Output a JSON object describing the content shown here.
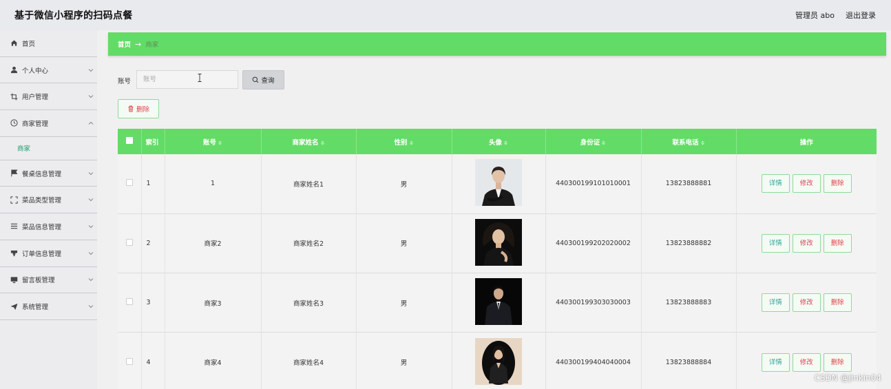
{
  "header": {
    "title": "基于微信小程序的扫码点餐",
    "user": "管理员 abo",
    "logout": "退出登录"
  },
  "sidebar": {
    "items": [
      {
        "label": "首页",
        "icon": "home-icon"
      },
      {
        "label": "个人中心",
        "icon": "user-icon"
      },
      {
        "label": "用户管理",
        "icon": "crop-icon"
      },
      {
        "label": "商家管理",
        "icon": "clock-icon",
        "expanded": true,
        "sub": [
          "商家"
        ]
      },
      {
        "label": "餐桌信息管理",
        "icon": "flag-icon"
      },
      {
        "label": "菜品类型管理",
        "icon": "fullscreen-icon"
      },
      {
        "label": "菜品信息管理",
        "icon": "list-icon"
      },
      {
        "label": "订单信息管理",
        "icon": "cup-icon"
      },
      {
        "label": "留言板管理",
        "icon": "monitor-icon"
      },
      {
        "label": "系统管理",
        "icon": "send-icon"
      }
    ]
  },
  "breadcrumb": {
    "home": "首页",
    "arrow": "→",
    "current": "商家"
  },
  "search": {
    "label": "账号",
    "placeholder": "账号",
    "button": "查询"
  },
  "toolbar": {
    "delete_label": "删除"
  },
  "table": {
    "columns": [
      "索引",
      "账号",
      "商家姓名",
      "性别",
      "头像",
      "身份证",
      "联系电话",
      "操作"
    ],
    "sortable": [
      false,
      true,
      true,
      true,
      true,
      true,
      true,
      false
    ],
    "rows": [
      {
        "index": "1",
        "account": "1",
        "name": "商家姓名1",
        "gender": "男",
        "avatar": "female-portrait-black-suit",
        "id_card": "440300199101010001",
        "phone": "13823888881"
      },
      {
        "index": "2",
        "account": "商家2",
        "name": "商家姓名2",
        "gender": "男",
        "avatar": "female-portrait-dark-curly-hair",
        "id_card": "440300199202020002",
        "phone": "13823888882"
      },
      {
        "index": "3",
        "account": "商家3",
        "name": "商家姓名3",
        "gender": "男",
        "avatar": "male-portrait-dark-suit",
        "id_card": "440300199303030003",
        "phone": "13823888883"
      },
      {
        "index": "4",
        "account": "商家4",
        "name": "商家姓名4",
        "gender": "男",
        "avatar": "female-portrait-oval-frame",
        "id_card": "440300199404040004",
        "phone": "13823888884"
      }
    ],
    "actions": {
      "detail": "详情",
      "edit": "修改",
      "delete": "删除"
    }
  },
  "watermark": "CSDN @jinkin04",
  "colors": {
    "accent": "#62dc66",
    "danger": "#e0424b",
    "info": "#2aa198"
  }
}
